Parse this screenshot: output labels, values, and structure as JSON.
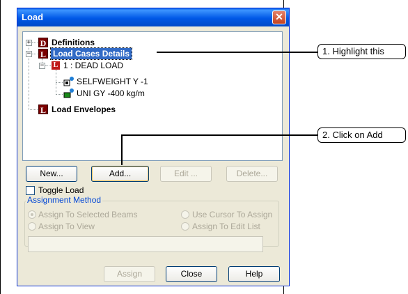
{
  "dialog": {
    "title": "Load",
    "close_glyph": "✕"
  },
  "tree": {
    "items": [
      {
        "label": "Definitions",
        "expander": "+",
        "icon": "D"
      },
      {
        "label": "Load Cases Details",
        "expander": "−",
        "icon": "L"
      },
      {
        "label": "1 : DEAD LOAD",
        "expander": "−",
        "icon": "L"
      },
      {
        "label": "SELFWEIGHT Y -1",
        "icon": "selfweight-icon"
      },
      {
        "label": "UNI GY -400 kg/m",
        "icon": "uniform-load-icon"
      },
      {
        "label": "Load Envelopes",
        "icon": "L"
      }
    ]
  },
  "buttons": {
    "new": "New...",
    "add": "Add...",
    "edit": "Edit ...",
    "delete": "Delete...",
    "assign": "Assign",
    "close": "Close",
    "help": "Help"
  },
  "toggle_load": {
    "label": "Toggle Load",
    "checked": false
  },
  "assignment_method": {
    "legend": "Assignment Method",
    "options": [
      "Assign To Selected Beams",
      "Use Cursor To Assign",
      "Assign To View",
      "Assign To Edit List"
    ],
    "selected": "Assign To Selected Beams"
  },
  "callouts": {
    "step1": "1. Highlight this",
    "step2": "2. Click on Add"
  },
  "colors": {
    "selection": "#316ac5",
    "titlebar": "#0058e6",
    "legend": "#0046d5"
  }
}
